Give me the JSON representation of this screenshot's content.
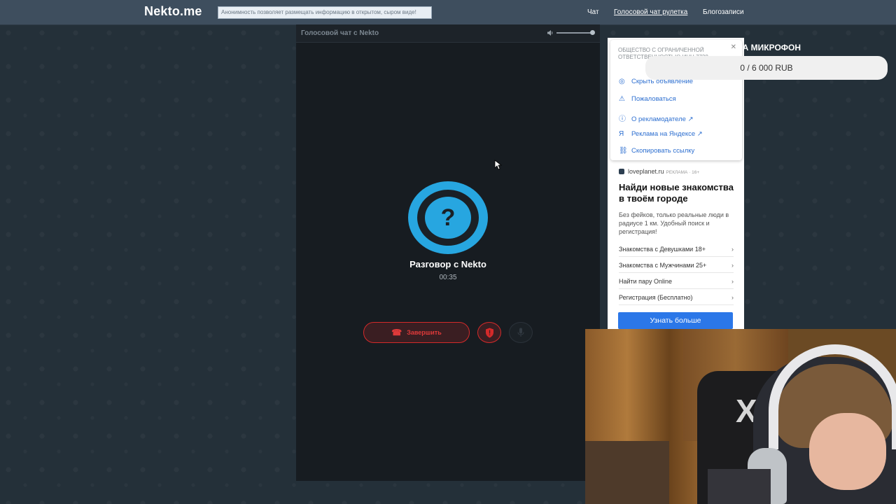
{
  "topbar": {
    "logo": "Nekto.me",
    "ticker": "Анонимность позволяет размещать информацию в открытом, сыром виде!",
    "nav": [
      "Чат",
      "Голосовой чат рулетка",
      "Блогозаписи"
    ]
  },
  "panel": {
    "title": "Голосовой чат с Nekto",
    "avatar_symbol": "?",
    "talk_name": "Разговор с Nekto",
    "talk_time": "00:35",
    "end_label": "Завершить",
    "colors": {
      "accent": "#27a6e0",
      "danger": "#e03a3a"
    }
  },
  "ad": {
    "legal": "ОБЩЕСТВО С ОГРАНИЧЕННОЙ ОТВЕТСТВЕННОСТЬЮ ИНН 7728",
    "menu": [
      {
        "icon": "eye-off-icon",
        "glyph": "◎",
        "label": "Скрыть объявление"
      },
      {
        "icon": "warning-icon",
        "glyph": "⚠",
        "label": "Пожаловаться"
      },
      {
        "icon": "info-icon",
        "glyph": "ⓘ",
        "label": "О рекламодателе ↗"
      },
      {
        "icon": "yandex-icon",
        "glyph": "Я",
        "label": "Реклама на Яндексе ↗"
      },
      {
        "icon": "link-icon",
        "glyph": "⛓",
        "label": "Скопировать ссылку"
      }
    ],
    "domain": "loveplanet.ru",
    "domain_tag": "РЕКЛАМА · 16+",
    "headline": "Найди новые знаком­ства в твоём городе",
    "body": "Без фейков, только реальные люди в радиусе 1 км. Удобный поиск и регистрация!",
    "links": [
      "Знакомства с Девушками 18+",
      "Знакомства с Мужчинами 25+",
      "Найти пару Online",
      "Регистрация (Бесплатно)"
    ],
    "cta": "Узнать больше"
  },
  "donation": {
    "label": "НА МИКРОФОН",
    "progress": "0 / 6 000 RUB"
  }
}
